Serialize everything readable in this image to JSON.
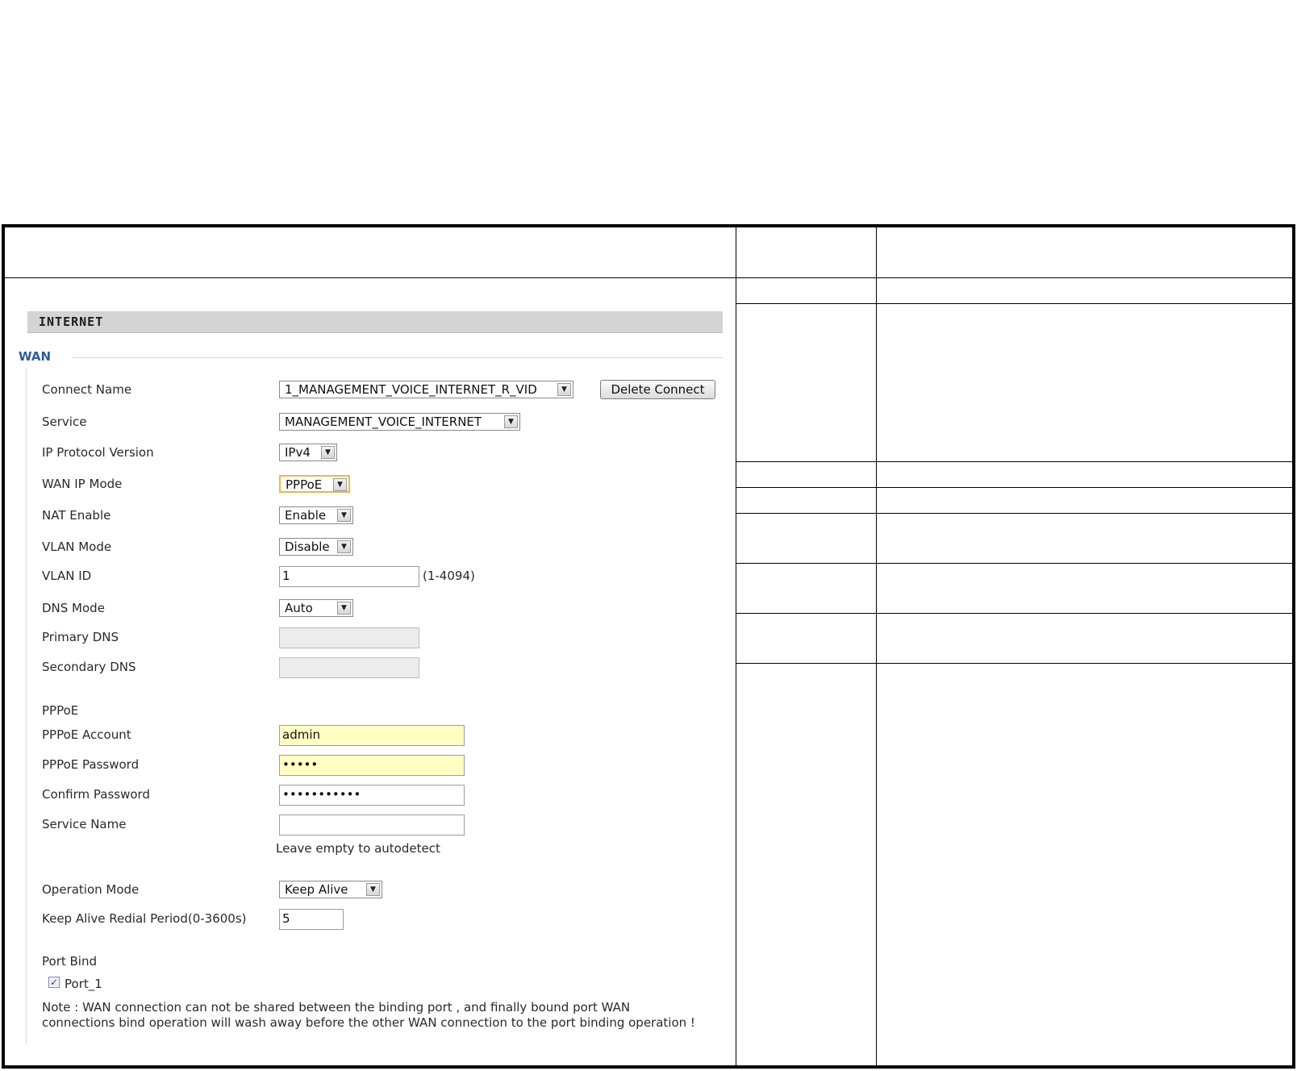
{
  "panel": {
    "section_title": "INTERNET",
    "group_title": "WAN"
  },
  "form": {
    "connect_name": {
      "label": "Connect Name",
      "value": "1_MANAGEMENT_VOICE_INTERNET_R_VID",
      "action": "Delete Connect"
    },
    "service": {
      "label": "Service",
      "value": "MANAGEMENT_VOICE_INTERNET"
    },
    "ip_protocol": {
      "label": "IP Protocol Version",
      "value": "IPv4"
    },
    "wan_ip_mode": {
      "label": "WAN IP Mode",
      "value": "PPPoE"
    },
    "nat_enable": {
      "label": "NAT Enable",
      "value": "Enable"
    },
    "vlan_mode": {
      "label": "VLAN Mode",
      "value": "Disable"
    },
    "vlan_id": {
      "label": "VLAN ID",
      "value": "1",
      "hint": "(1-4094)"
    },
    "dns_mode": {
      "label": "DNS Mode",
      "value": "Auto"
    },
    "primary_dns": {
      "label": "Primary DNS",
      "value": ""
    },
    "secondary_dns": {
      "label": "Secondary DNS",
      "value": ""
    },
    "pppoe_heading": "PPPoE",
    "pppoe_account": {
      "label": "PPPoE Account",
      "value": "admin"
    },
    "pppoe_password": {
      "label": "PPPoE Password",
      "value": "•••••"
    },
    "confirm_password": {
      "label": "Confirm Password",
      "value": "•••••••••••"
    },
    "service_name": {
      "label": "Service Name",
      "value": "",
      "hint": "Leave empty to autodetect"
    },
    "operation_mode": {
      "label": "Operation Mode",
      "value": "Keep Alive"
    },
    "keep_alive_period": {
      "label": "Keep Alive Redial Period(0-3600s)",
      "value": "5"
    },
    "port_bind": {
      "label": "Port Bind",
      "port_label": "Port_1",
      "checked": true
    },
    "note_line1": "Note : WAN connection can not be shared between the binding port , and finally bound port WAN",
    "note_line2": "connections bind operation will wash away before the other WAN connection to the port binding operation !"
  },
  "icons": {
    "dropdown_arrow": "▼",
    "checkmark": "✓"
  }
}
